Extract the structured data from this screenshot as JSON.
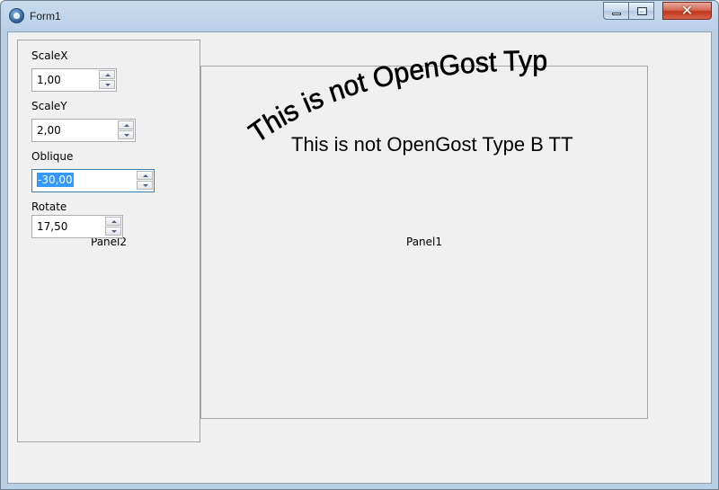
{
  "window": {
    "title": "Form1"
  },
  "controls": {
    "scalex": {
      "label": "ScaleX",
      "value": "1,00"
    },
    "scaley": {
      "label": "ScaleY",
      "value": "2,00"
    },
    "oblique": {
      "label": "Oblique",
      "value": "-30,00"
    },
    "rotate": {
      "label": "Rotate",
      "value": "17,50"
    }
  },
  "panels": {
    "panel2_caption": "Panel2",
    "panel1_caption": "Panel1"
  },
  "preview": {
    "transformed_text": "This is not OpenGost Type B TT",
    "plain_text": "This is not OpenGost Type B TT"
  }
}
